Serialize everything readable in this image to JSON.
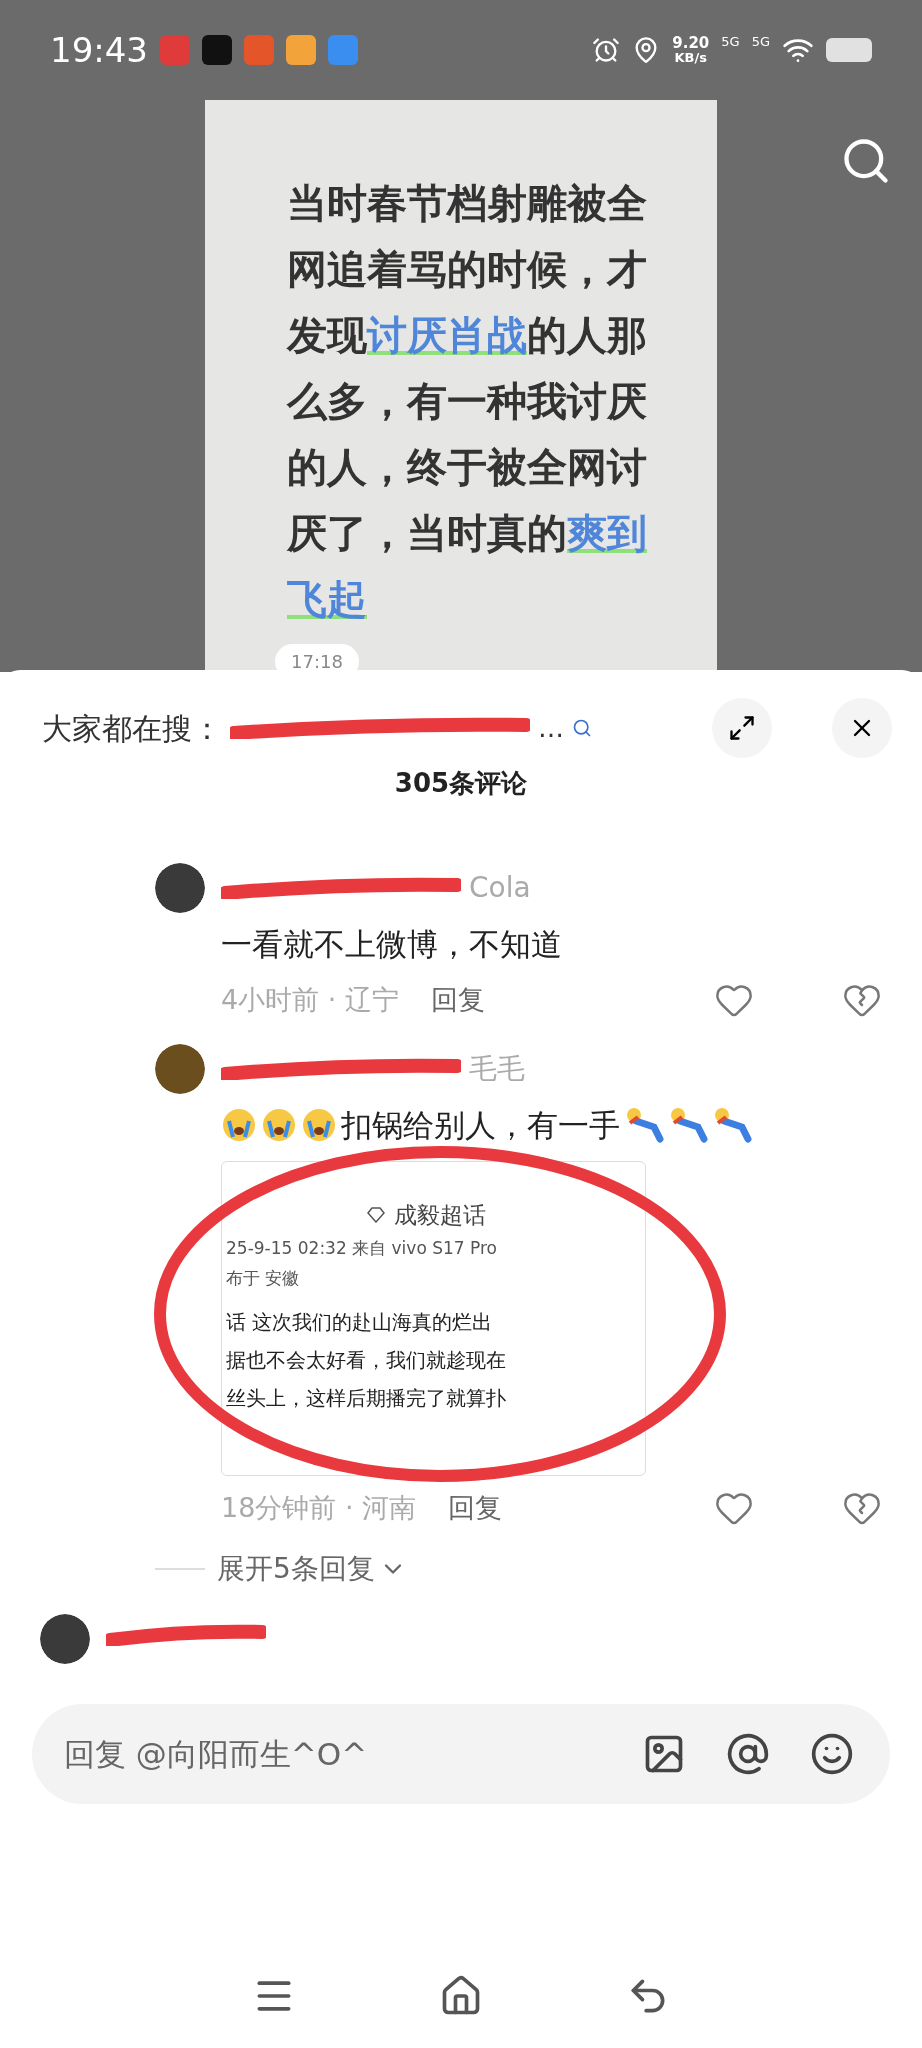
{
  "status_bar": {
    "time": "19:43",
    "net_speed": "9.20",
    "net_unit": "KB/s",
    "sim1": "5G",
    "sim2": "5G"
  },
  "video": {
    "caption_lines": [
      [
        {
          "text": "当时春节档射雕被全",
          "highlight": false
        }
      ],
      [
        {
          "text": "网追着骂的时候，才",
          "highlight": false
        }
      ],
      [
        {
          "text": "发现",
          "highlight": false
        },
        {
          "text": "讨厌肖战",
          "highlight": true
        },
        {
          "text": "的人那",
          "highlight": false
        }
      ],
      [
        {
          "text": "么多，有一种我讨厌",
          "highlight": false
        }
      ],
      [
        {
          "text": "的人，终于被全网讨",
          "highlight": false
        }
      ],
      [
        {
          "text": "厌了，当时真的",
          "highlight": false
        },
        {
          "text": "爽到",
          "highlight": true
        }
      ],
      [
        {
          "text": "飞起",
          "highlight": true
        }
      ]
    ],
    "timestamp": "17:18"
  },
  "sheet": {
    "search_label": "大家都在搜：",
    "search_tail": "…",
    "comment_count": "305条评论",
    "comments": [
      {
        "avatar": {
          "color": "#3a3a3a"
        },
        "name": "Cola",
        "text": "一看就不上微博，不知道",
        "time": "4小时前 · 辽宁",
        "reply": "回复"
      },
      {
        "avatar": {
          "color": "#6b4e1d"
        },
        "name": "毛毛",
        "text": "扣锅给别人，有一手",
        "emojis_before": [
          {
            "kind": "crying"
          },
          {
            "kind": "crying"
          },
          {
            "kind": "crying"
          }
        ],
        "emojis_after": [
          {
            "kind": "tumbling"
          },
          {
            "kind": "tumbling"
          },
          {
            "kind": "tumbling"
          }
        ],
        "time": "18分钟前 · 河南",
        "reply": "回复",
        "embedded_post": {
          "topic": "成毅超话",
          "meta": "25-9-15 02:32  来自 vivo S17 Pro",
          "location": "布于 安徽",
          "lines": [
            "话  这次我们的赴山海真的烂出",
            "据也不会太好看，我们就趁现在",
            "丝头上，这样后期播完了就算扑"
          ]
        }
      }
    ],
    "expand_replies": "展开5条回复",
    "reply_placeholder": "回复 @向阳而生^O^"
  }
}
